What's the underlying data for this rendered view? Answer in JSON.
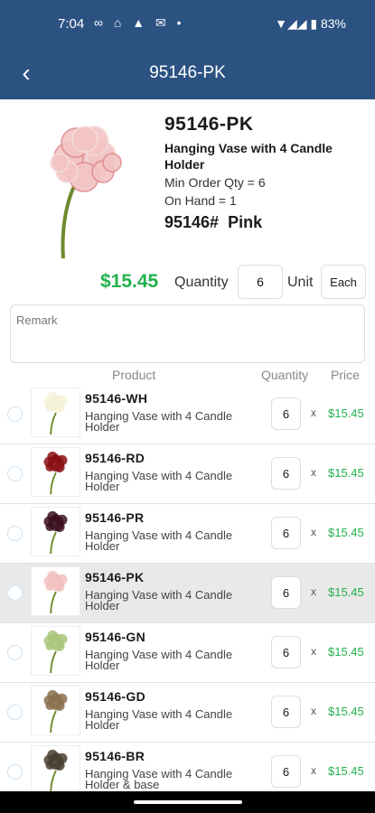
{
  "status": {
    "time": "7:04",
    "battery": "83%"
  },
  "appbar": {
    "title": "95146-PK"
  },
  "product": {
    "code": "95146-PK",
    "name": "Hanging Vase with 4 Candle Holder",
    "min_order": "Min Order Qty = 6",
    "on_hand": "On Hand = 1",
    "item_no": "95146#",
    "color": "Pink",
    "price": "$15.45",
    "quantity_label": "Quantity",
    "quantity_value": "6",
    "unit_label": "Unit",
    "unit_value": "Each",
    "remark_placeholder": "Remark",
    "flower_color": "#f2c4c4"
  },
  "headers": {
    "product": "Product",
    "quantity": "Quantity",
    "price": "Price"
  },
  "rows": [
    {
      "code": "95146-WH",
      "desc": "Hanging Vase with 4 Candle Holder",
      "qty": "6",
      "times": "x",
      "price": "$15.45",
      "flower": "#f4f1d8",
      "selected": false
    },
    {
      "code": "95146-RD",
      "desc": "Hanging Vase with 4 Candle Holder",
      "qty": "6",
      "times": "x",
      "price": "$15.45",
      "flower": "#8b0f14",
      "selected": false
    },
    {
      "code": "95146-PR",
      "desc": "Hanging Vase with 4 Candle Holder",
      "qty": "6",
      "times": "x",
      "price": "$15.45",
      "flower": "#3b1020",
      "selected": false
    },
    {
      "code": "95146-PK",
      "desc": "Hanging Vase with 4 Candle Holder",
      "qty": "6",
      "times": "x",
      "price": "$15.45",
      "flower": "#f2c0c0",
      "selected": true
    },
    {
      "code": "95146-GN",
      "desc": "Hanging Vase with 4 Candle Holder",
      "qty": "6",
      "times": "x",
      "price": "$15.45",
      "flower": "#a9c77a",
      "selected": false
    },
    {
      "code": "95146-GD",
      "desc": "Hanging Vase with 4 Candle Holder",
      "qty": "6",
      "times": "x",
      "price": "$15.45",
      "flower": "#8a7150",
      "selected": false
    },
    {
      "code": "95146-BR",
      "desc": "Hanging Vase with 4 Candle Holder & base",
      "qty": "6",
      "times": "x",
      "price": "$15.45",
      "flower": "#4a4030",
      "selected": false
    }
  ],
  "colors": {
    "header": "#2c5282",
    "price_green": "#22b14c",
    "selected_row": "#e9e9e9"
  }
}
